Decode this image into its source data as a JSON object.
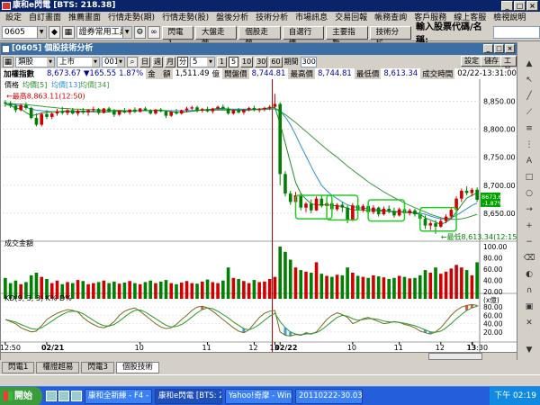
{
  "window": {
    "title": "康和e閃電 [BTS: 218.38]"
  },
  "menu": [
    "設定",
    "自訂畫面",
    "推薦畫面",
    "行情走勢(期)",
    "行情走勢(股)",
    "盤後分析",
    "技術分析",
    "市場訊息",
    "交易回報",
    "帳務查詢",
    "客戶服務",
    "線上客服",
    "檢視說明"
  ],
  "toolbar": {
    "account_combo": "0605",
    "tool_combo": "證券常用工具",
    "buttons": [
      "閃電1",
      "大盤走勢",
      "個股走勢",
      "自選行情",
      "主要指數",
      "技術分析"
    ],
    "search_label": "輸入股票代碼/名稱:"
  },
  "panel": {
    "title": "[0605] 個股技術分析",
    "cat_select": "類股",
    "market_select": "上市",
    "code_select": "001",
    "period_buttons": [
      "日",
      "週",
      "月",
      "分"
    ],
    "minute_value": "5",
    "interval_buttons": [
      "1",
      "5",
      "10",
      "30",
      "60"
    ],
    "period_label": "期間",
    "period_value": "300",
    "right_buttons": [
      "設定",
      "儲存",
      "工具"
    ],
    "index_name": "加權指數",
    "price": "8,673.67",
    "change": "▼165.55",
    "change_pct": "1.87%",
    "volume_label": "金　額",
    "volume": "1,511.49",
    "volume_unit": "億",
    "open_label": "開盤價",
    "open": "8,744.81",
    "high_label": "最高價",
    "high": "8,744.81",
    "low_label": "最低價",
    "low": "8,613.34",
    "time_label": "成交時間",
    "time": "02/22-13:31:00"
  },
  "chart_data": {
    "type": "candlestick",
    "legend": {
      "label": "價格",
      "ma": [
        "均價[5]",
        "均價[13]",
        "均價[34]"
      ]
    },
    "ma_colors": [
      "#228b22",
      "#2a8fd4",
      "#3a9a3a"
    ],
    "y_ticks": [
      8850,
      8800,
      8750,
      8700,
      8650
    ],
    "ylim": [
      8600,
      8870
    ],
    "annotations": {
      "high": "←最高8,863.11(12:50)",
      "low": "←最低8,613.34(12:15)"
    },
    "current_price_label": [
      "8673.67",
      "-1.87%"
    ],
    "volume_label": "成交金額",
    "volume_ticks": [
      "100.00",
      "80.00",
      "60.00",
      "40.00",
      "20.00"
    ],
    "volume_unit": "(x億)",
    "kd_label": "KD(9, 3, 3) K% D%",
    "kd_ticks": [
      "80.00",
      "60.00",
      "40.00",
      "20.00"
    ],
    "x_labels": [
      "12:50",
      "02/21",
      "10",
      "11",
      "12",
      "13",
      "02/22",
      "10",
      "11",
      "12",
      "13",
      "13:30"
    ],
    "x_bold": [
      "02/21",
      "02/22"
    ],
    "candles": [
      [
        8848,
        8852,
        8840,
        8846
      ],
      [
        8846,
        8850,
        8838,
        8842
      ],
      [
        8842,
        8845,
        8830,
        8834
      ],
      [
        8834,
        8845,
        8832,
        8843
      ],
      [
        8843,
        8848,
        8835,
        8838
      ],
      [
        8838,
        8840,
        8818,
        8820
      ],
      [
        8820,
        8828,
        8805,
        8808
      ],
      [
        8808,
        8830,
        8805,
        8827
      ],
      [
        8827,
        8834,
        8818,
        8822
      ],
      [
        8822,
        8830,
        8818,
        8828
      ],
      [
        8828,
        8836,
        8824,
        8832
      ],
      [
        8832,
        8840,
        8826,
        8829
      ],
      [
        8829,
        8836,
        8825,
        8834
      ],
      [
        8834,
        8838,
        8826,
        8828
      ],
      [
        8828,
        8835,
        8824,
        8833
      ],
      [
        8833,
        8838,
        8827,
        8830
      ],
      [
        8830,
        8836,
        8824,
        8834
      ],
      [
        8834,
        8840,
        8830,
        8836
      ],
      [
        8836,
        8838,
        8826,
        8829
      ],
      [
        8829,
        8838,
        8828,
        8837
      ],
      [
        8837,
        8840,
        8830,
        8832
      ],
      [
        8832,
        8836,
        8822,
        8826
      ],
      [
        8826,
        8834,
        8824,
        8833
      ],
      [
        8833,
        8838,
        8828,
        8830
      ],
      [
        8830,
        8836,
        8826,
        8835
      ],
      [
        8835,
        8839,
        8829,
        8831
      ],
      [
        8831,
        8838,
        8830,
        8837
      ],
      [
        8837,
        8840,
        8832,
        8834
      ],
      [
        8834,
        8836,
        8826,
        8828
      ],
      [
        8828,
        8836,
        8826,
        8835
      ],
      [
        8835,
        8838,
        8830,
        8832
      ],
      [
        8832,
        8834,
        8820,
        8824
      ],
      [
        8824,
        8832,
        8822,
        8831
      ],
      [
        8831,
        8836,
        8826,
        8828
      ],
      [
        8828,
        8835,
        8826,
        8834
      ],
      [
        8834,
        8840,
        8830,
        8837
      ],
      [
        8837,
        8842,
        8834,
        8839
      ],
      [
        8839,
        8842,
        8830,
        8833
      ],
      [
        8833,
        8838,
        8830,
        8836
      ],
      [
        8836,
        8840,
        8830,
        8832
      ],
      [
        8832,
        8838,
        8828,
        8837
      ],
      [
        8837,
        8842,
        8834,
        8840
      ],
      [
        8840,
        8844,
        8835,
        8837
      ],
      [
        8837,
        8840,
        8826,
        8828
      ],
      [
        8828,
        8835,
        8826,
        8834
      ],
      [
        8834,
        8838,
        8828,
        8830
      ],
      [
        8830,
        8836,
        8826,
        8835
      ],
      [
        8835,
        8840,
        8832,
        8838
      ],
      [
        8838,
        8842,
        8832,
        8834
      ],
      [
        8834,
        8838,
        8830,
        8836
      ],
      [
        8836,
        8840,
        8832,
        8838
      ],
      [
        8838,
        8843,
        8834,
        8840
      ],
      [
        8840,
        8863,
        8838,
        8845
      ],
      [
        8845,
        8848,
        8700,
        8720
      ],
      [
        8720,
        8725,
        8680,
        8685
      ],
      [
        8685,
        8690,
        8665,
        8670
      ],
      [
        8670,
        8688,
        8665,
        8682
      ],
      [
        8682,
        8686,
        8655,
        8660
      ],
      [
        8660,
        8670,
        8652,
        8667
      ],
      [
        8667,
        8675,
        8650,
        8655
      ],
      [
        8655,
        8680,
        8654,
        8676
      ],
      [
        8676,
        8682,
        8660,
        8663
      ],
      [
        8663,
        8670,
        8652,
        8668
      ],
      [
        8668,
        8672,
        8655,
        8657
      ],
      [
        8657,
        8668,
        8654,
        8665
      ],
      [
        8665,
        8670,
        8652,
        8660
      ],
      [
        8660,
        8664,
        8632,
        8638
      ],
      [
        8638,
        8668,
        8636,
        8664
      ],
      [
        8664,
        8668,
        8650,
        8655
      ],
      [
        8655,
        8666,
        8652,
        8663
      ],
      [
        8663,
        8666,
        8648,
        8652
      ],
      [
        8652,
        8664,
        8648,
        8660
      ],
      [
        8660,
        8662,
        8644,
        8648
      ],
      [
        8648,
        8662,
        8646,
        8658
      ],
      [
        8658,
        8664,
        8650,
        8654
      ],
      [
        8654,
        8660,
        8642,
        8646
      ],
      [
        8646,
        8660,
        8644,
        8657
      ],
      [
        8657,
        8660,
        8646,
        8650
      ],
      [
        8650,
        8658,
        8646,
        8655
      ],
      [
        8655,
        8658,
        8644,
        8648
      ],
      [
        8648,
        8655,
        8636,
        8640
      ],
      [
        8640,
        8646,
        8622,
        8628
      ],
      [
        8628,
        8636,
        8620,
        8632
      ],
      [
        8632,
        8638,
        8613,
        8626
      ],
      [
        8626,
        8640,
        8624,
        8636
      ],
      [
        8636,
        8648,
        8632,
        8644
      ],
      [
        8644,
        8660,
        8640,
        8656
      ],
      [
        8656,
        8680,
        8652,
        8676
      ],
      [
        8676,
        8694,
        8670,
        8690
      ],
      [
        8690,
        8698,
        8682,
        8686
      ],
      [
        8686,
        8695,
        8680,
        8692
      ],
      [
        8692,
        8696,
        8670,
        8674
      ]
    ],
    "ma5": [
      8845,
      8842,
      8838,
      8836,
      8830,
      8824,
      8826,
      8829,
      8830,
      8831,
      8831,
      8832,
      8833,
      8832,
      8832,
      8832,
      8832,
      8832,
      8831,
      8831,
      8831,
      8832,
      8832,
      8831,
      8832,
      8833,
      8833,
      8834,
      8833,
      8834,
      8834,
      8833,
      8831,
      8830,
      8830,
      8831,
      8832,
      8833,
      8834,
      8835,
      8836,
      8837,
      8837,
      8836,
      8834,
      8834,
      8833,
      8834,
      8835,
      8836,
      8837,
      8838,
      8839,
      8810,
      8775,
      8740,
      8705,
      8685,
      8675,
      8667,
      8665,
      8665,
      8665,
      8664,
      8663,
      8662,
      8659,
      8656,
      8656,
      8656,
      8654,
      8655,
      8654,
      8654,
      8653,
      8652,
      8652,
      8652,
      8651,
      8650,
      8648,
      8642,
      8638,
      8634,
      8630,
      8634,
      8640,
      8652,
      8665,
      8677,
      8682,
      8686
    ],
    "ma13": [
      8846,
      8845,
      8843,
      8841,
      8839,
      8836,
      8834,
      8833,
      8832,
      8831,
      8831,
      8831,
      8831,
      8831,
      8831,
      8831,
      8831,
      8831,
      8831,
      8831,
      8831,
      8832,
      8832,
      8832,
      8832,
      8833,
      8833,
      8833,
      8833,
      8833,
      8833,
      8833,
      8833,
      8833,
      8833,
      8833,
      8833,
      8834,
      8834,
      8834,
      8835,
      8835,
      8836,
      8836,
      8836,
      8836,
      8836,
      8836,
      8836,
      8836,
      8836,
      8837,
      8838,
      8832,
      8822,
      8808,
      8790,
      8770,
      8752,
      8733,
      8716,
      8700,
      8690,
      8682,
      8676,
      8670,
      8665,
      8662,
      8660,
      8659,
      8658,
      8657,
      8656,
      8655,
      8654,
      8653,
      8653,
      8652,
      8652,
      8651,
      8650,
      8648,
      8645,
      8642,
      8640,
      8640,
      8642,
      8646,
      8652,
      8658,
      8664,
      8668
    ],
    "ma34": [
      8846,
      8846,
      8845,
      8845,
      8844,
      8843,
      8842,
      8841,
      8840,
      8839,
      8838,
      8837,
      8837,
      8836,
      8836,
      8835,
      8835,
      8835,
      8834,
      8834,
      8834,
      8834,
      8834,
      8833,
      8833,
      8833,
      8833,
      8833,
      8833,
      8833,
      8833,
      8833,
      8833,
      8833,
      8833,
      8833,
      8833,
      8834,
      8834,
      8834,
      8834,
      8834,
      8834,
      8834,
      8835,
      8835,
      8835,
      8835,
      8835,
      8835,
      8835,
      8836,
      8836,
      8832,
      8826,
      8819,
      8812,
      8804,
      8796,
      8788,
      8780,
      8772,
      8764,
      8757,
      8750,
      8742,
      8734,
      8727,
      8720,
      8713,
      8706,
      8700,
      8694,
      8688,
      8683,
      8678,
      8673,
      8668,
      8664,
      8660,
      8656,
      8652,
      8648,
      8645,
      8642,
      8640,
      8639,
      8639,
      8640,
      8642,
      8645,
      8648
    ],
    "volumes": [
      40,
      30,
      35,
      28,
      32,
      45,
      50,
      42,
      38,
      30,
      35,
      28,
      32,
      30,
      36,
      34,
      28,
      30,
      32,
      35,
      30,
      33,
      29,
      31,
      34,
      30,
      28,
      32,
      35,
      30,
      33,
      36,
      30,
      28,
      31,
      34,
      30,
      29,
      33,
      37,
      32,
      30,
      35,
      60,
      40,
      38,
      34,
      30,
      36,
      32,
      33,
      38,
      42,
      100,
      90,
      75,
      60,
      55,
      52,
      50,
      70,
      48,
      44,
      42,
      46,
      45,
      60,
      50,
      44,
      42,
      40,
      45,
      43,
      41,
      38,
      40,
      44,
      42,
      39,
      40,
      45,
      55,
      50,
      60,
      48,
      52,
      58,
      65,
      60,
      55,
      45,
      70
    ],
    "kd_k": [
      50,
      45,
      40,
      30,
      25,
      20,
      22,
      35,
      50,
      58,
      65,
      70,
      74,
      72,
      68,
      55,
      45,
      38,
      32,
      30,
      35,
      45,
      60,
      70,
      75,
      78,
      70,
      60,
      50,
      40,
      32,
      28,
      30,
      38,
      50,
      60,
      72,
      80,
      82,
      78,
      70,
      60,
      50,
      40,
      30,
      22,
      18,
      25,
      40,
      55,
      65,
      70,
      72,
      20,
      12,
      10,
      14,
      12,
      18,
      15,
      20,
      35,
      50,
      60,
      66,
      62,
      55,
      40,
      45,
      52,
      55,
      50,
      45,
      40,
      42,
      45,
      43,
      38,
      35,
      30,
      22,
      18,
      15,
      20,
      30,
      45,
      60,
      72,
      80,
      84,
      86,
      84
    ],
    "kd_d": [
      50,
      47,
      44,
      38,
      33,
      28,
      26,
      30,
      38,
      46,
      55,
      62,
      68,
      70,
      69,
      64,
      56,
      48,
      40,
      35,
      34,
      38,
      46,
      56,
      65,
      72,
      73,
      68,
      60,
      52,
      44,
      36,
      32,
      33,
      38,
      46,
      56,
      66,
      74,
      78,
      76,
      70,
      62,
      54,
      44,
      36,
      28,
      25,
      30,
      38,
      48,
      58,
      65,
      45,
      30,
      20,
      15,
      13,
      15,
      16,
      18,
      25,
      35,
      45,
      55,
      60,
      58,
      52,
      48,
      50,
      52,
      52,
      50,
      46,
      44,
      44,
      43,
      41,
      38,
      35,
      30,
      25,
      20,
      19,
      22,
      30,
      40,
      52,
      62,
      72,
      78,
      82
    ],
    "highlight_boxes": [
      [
        57,
        62,
        8682,
        8640
      ],
      [
        63,
        67,
        8682,
        8638
      ],
      [
        71,
        76,
        8674,
        8636
      ],
      [
        81,
        86,
        8660,
        8618
      ]
    ],
    "session_split_index": 52
  },
  "bottom_tabs": [
    "閃電1",
    "權證超易",
    "閃電3",
    "個股技術"
  ],
  "taskbar": {
    "start": "開始",
    "items": [
      "康和全新練 - F4 - 行...",
      "康和e閃電 [BTS: 21...",
      "Yahoo!奇摩 - Windo...",
      "20110222-30.03P - 小..."
    ],
    "clock": "下午 02:19"
  }
}
